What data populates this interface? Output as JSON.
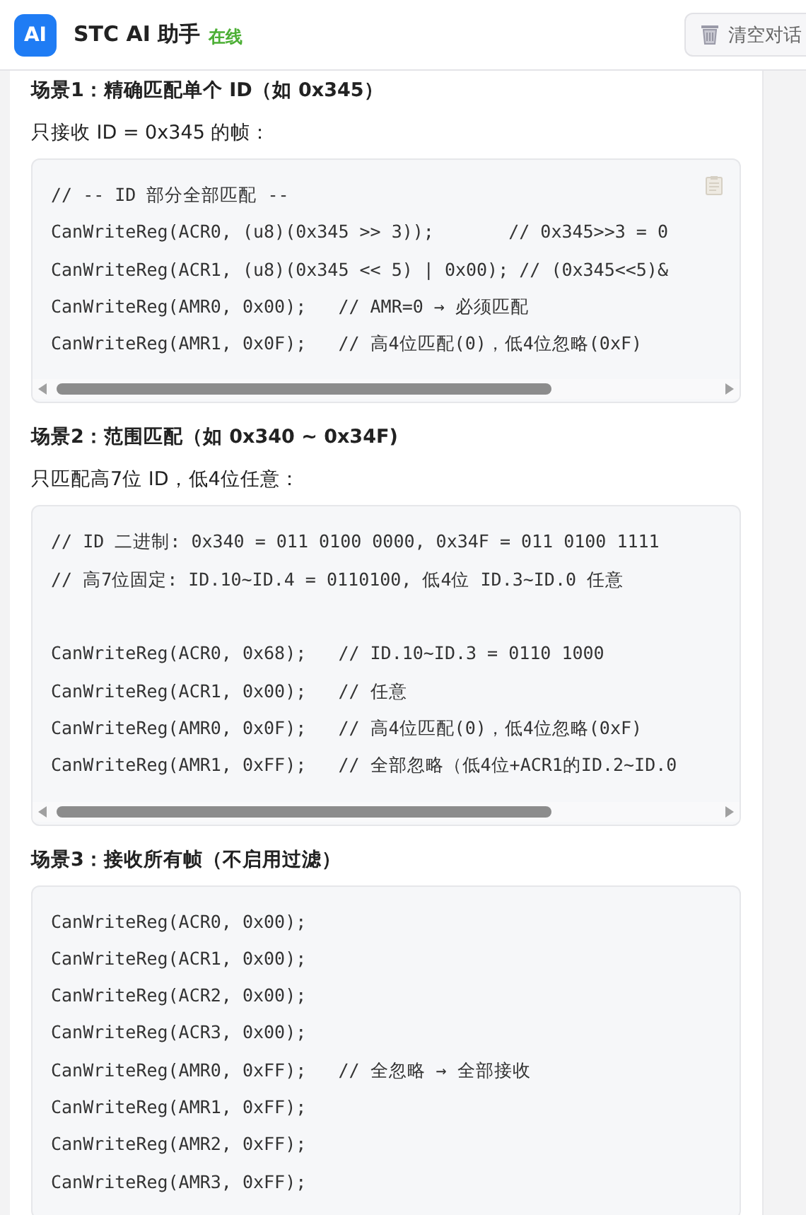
{
  "header": {
    "logo": "AI",
    "title": "STC AI 助手",
    "status": "在线",
    "clear_button": "清空对话"
  },
  "sections": [
    {
      "heading": "场景1：精确匹配单个 ID（如 0x345）",
      "description": "只接收 ID = 0x345 的帧：",
      "code": {
        "copy_button": true,
        "horizontal_scrollbar": true,
        "groups": [
          [
            "// -- ID 部分全部匹配 --",
            "CanWriteReg(ACR0, (u8)(0x345 >> 3));       // 0x345>>3 = 0",
            "CanWriteReg(ACR1, (u8)(0x345 << 5) | 0x00); // (0x345<<5)&",
            "CanWriteReg(AMR0, 0x00);   // AMR=0 → 必须匹配",
            "CanWriteReg(AMR1, 0x0F);   // 高4位匹配(0)，低4位忽略(0xF)"
          ]
        ]
      }
    },
    {
      "heading": "场景2：范围匹配（如 0x340 ~ 0x34F)",
      "description": "只匹配高7位 ID，低4位任意：",
      "code": {
        "copy_button": false,
        "horizontal_scrollbar": true,
        "groups": [
          [
            "// ID 二进制: 0x340 = 011 0100 0000, 0x34F = 011 0100 1111",
            "// 高7位固定: ID.10~ID.4 = 0110100, 低4位 ID.3~ID.0 任意"
          ],
          [
            "CanWriteReg(ACR0, 0x68);   // ID.10~ID.3 = 0110 1000",
            "CanWriteReg(ACR1, 0x00);   // 任意",
            "CanWriteReg(AMR0, 0x0F);   // 高4位匹配(0)，低4位忽略(0xF)",
            "CanWriteReg(AMR1, 0xFF);   // 全部忽略（低4位+ACR1的ID.2~ID.0"
          ]
        ]
      }
    },
    {
      "heading": "场景3：接收所有帧（不启用过滤）",
      "code": {
        "copy_button": false,
        "horizontal_scrollbar": false,
        "groups": [
          [
            "CanWriteReg(ACR0, 0x00);",
            "CanWriteReg(ACR1, 0x00);",
            "CanWriteReg(ACR2, 0x00);",
            "CanWriteReg(ACR3, 0x00);",
            "CanWriteReg(AMR0, 0xFF);   // 全忽略 → 全部接收",
            "CanWriteReg(AMR1, 0xFF);",
            "CanWriteReg(AMR2, 0xFF);",
            "CanWriteReg(AMR3, 0xFF);"
          ]
        ]
      }
    }
  ]
}
